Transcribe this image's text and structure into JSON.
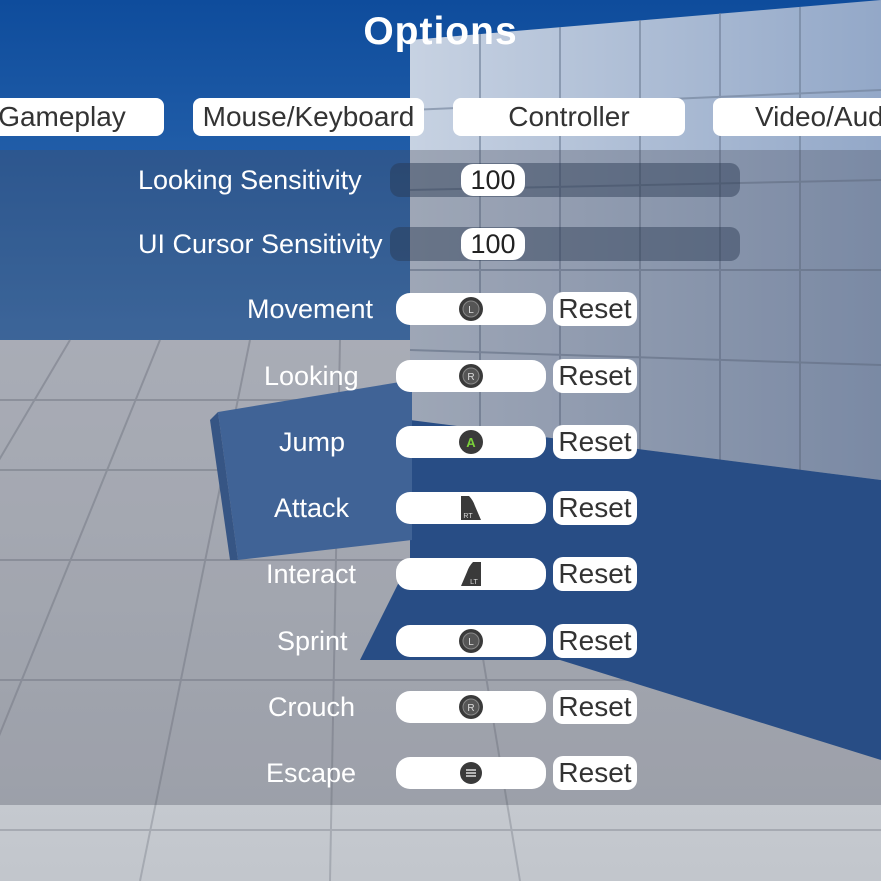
{
  "title": "Options",
  "tabs": [
    {
      "label": "Gameplay"
    },
    {
      "label": "Mouse/Keyboard"
    },
    {
      "label": "Controller"
    },
    {
      "label": "Video/Audio"
    }
  ],
  "sliders": [
    {
      "label": "Looking Sensitivity",
      "value": "100"
    },
    {
      "label": "UI Cursor Sensitivity",
      "value": "100"
    }
  ],
  "bindings": [
    {
      "label": "Movement",
      "glyph": "left-stick-icon",
      "reset_label": "Reset"
    },
    {
      "label": "Looking",
      "glyph": "right-stick-icon",
      "reset_label": "Reset"
    },
    {
      "label": "Jump",
      "glyph": "a-button-icon",
      "reset_label": "Reset"
    },
    {
      "label": "Attack",
      "glyph": "right-trigger-icon",
      "reset_label": "Reset"
    },
    {
      "label": "Interact",
      "glyph": "left-trigger-icon",
      "reset_label": "Reset"
    },
    {
      "label": "Sprint",
      "glyph": "left-stick-icon",
      "reset_label": "Reset"
    },
    {
      "label": "Crouch",
      "glyph": "right-stick-icon",
      "reset_label": "Reset"
    },
    {
      "label": "Escape",
      "glyph": "menu-button-icon",
      "reset_label": "Reset"
    }
  ],
  "glyph_text": {
    "left_stick": "L",
    "right_stick": "R",
    "a_button": "A",
    "right_trigger": "RT",
    "left_trigger": "LT"
  },
  "colors": {
    "sky": "#1a56a6",
    "floor": "#c9ccd2",
    "wall": "#a9b9d0",
    "a_button": "#7bd13a"
  }
}
